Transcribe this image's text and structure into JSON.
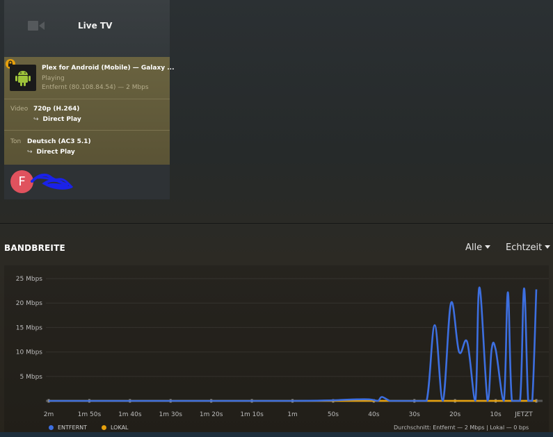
{
  "session": {
    "title": "Live TV",
    "device_name": "Plex for Android (Mobile)  —  Galaxy ...",
    "state": "Playing",
    "address": "Entfernt (80.108.84.54) — 2 Mbps",
    "video_label": "Video",
    "video_value": "720p (H.264)",
    "video_mode": "Direct Play",
    "audio_label": "Ton",
    "audio_value": "Deutsch (AC3 5.1)",
    "audio_mode": "Direct Play",
    "user_initial": "F"
  },
  "bandwidth": {
    "title": "BANDBREITE",
    "filter_label": "Alle",
    "range_label": "Echtzeit",
    "legend_remote": "ENTFERNT",
    "legend_local": "LOKAL",
    "summary": "Durchschnitt: Entfernt — 2 Mbps | Lokal — 0 bps"
  },
  "colors": {
    "remote": "#3d6fe0",
    "local": "#e5a00d",
    "avatar": "#e0525e",
    "playing_card": "#6a6340"
  },
  "chart_data": {
    "type": "line",
    "x_labels": [
      "2m",
      "1m 50s",
      "1m 40s",
      "1m 30s",
      "1m 20s",
      "1m 10s",
      "1m",
      "50s",
      "40s",
      "30s",
      "20s",
      "10s",
      "JETZT"
    ],
    "y_ticks": [
      "5 Mbps",
      "10 Mbps",
      "15 Mbps",
      "20 Mbps",
      "25 Mbps"
    ],
    "ylim": [
      0,
      25
    ],
    "xlim": [
      -120,
      0
    ],
    "series": [
      {
        "name": "ENTFERNT",
        "color": "#3d6fe0",
        "x": [
          -120,
          -60,
          -45,
          -41,
          -39,
          -38,
          -36,
          -34,
          -30,
          -27,
          -25,
          -23,
          -21,
          -19,
          -17,
          -15,
          -14,
          -12,
          -11,
          -10,
          -8,
          -7,
          -6,
          -4,
          -3,
          -2,
          -1,
          0
        ],
        "y": [
          0,
          0,
          0.3,
          0.3,
          0,
          0.8,
          0,
          0,
          0,
          0,
          15.5,
          0,
          20,
          10,
          12,
          0,
          23.2,
          0,
          10.5,
          10.5,
          0,
          22.2,
          0,
          0,
          23,
          0,
          0,
          22.8
        ]
      },
      {
        "name": "LOKAL",
        "color": "#e5a00d",
        "x": [
          -120,
          0
        ],
        "y": [
          0,
          0
        ]
      }
    ]
  }
}
